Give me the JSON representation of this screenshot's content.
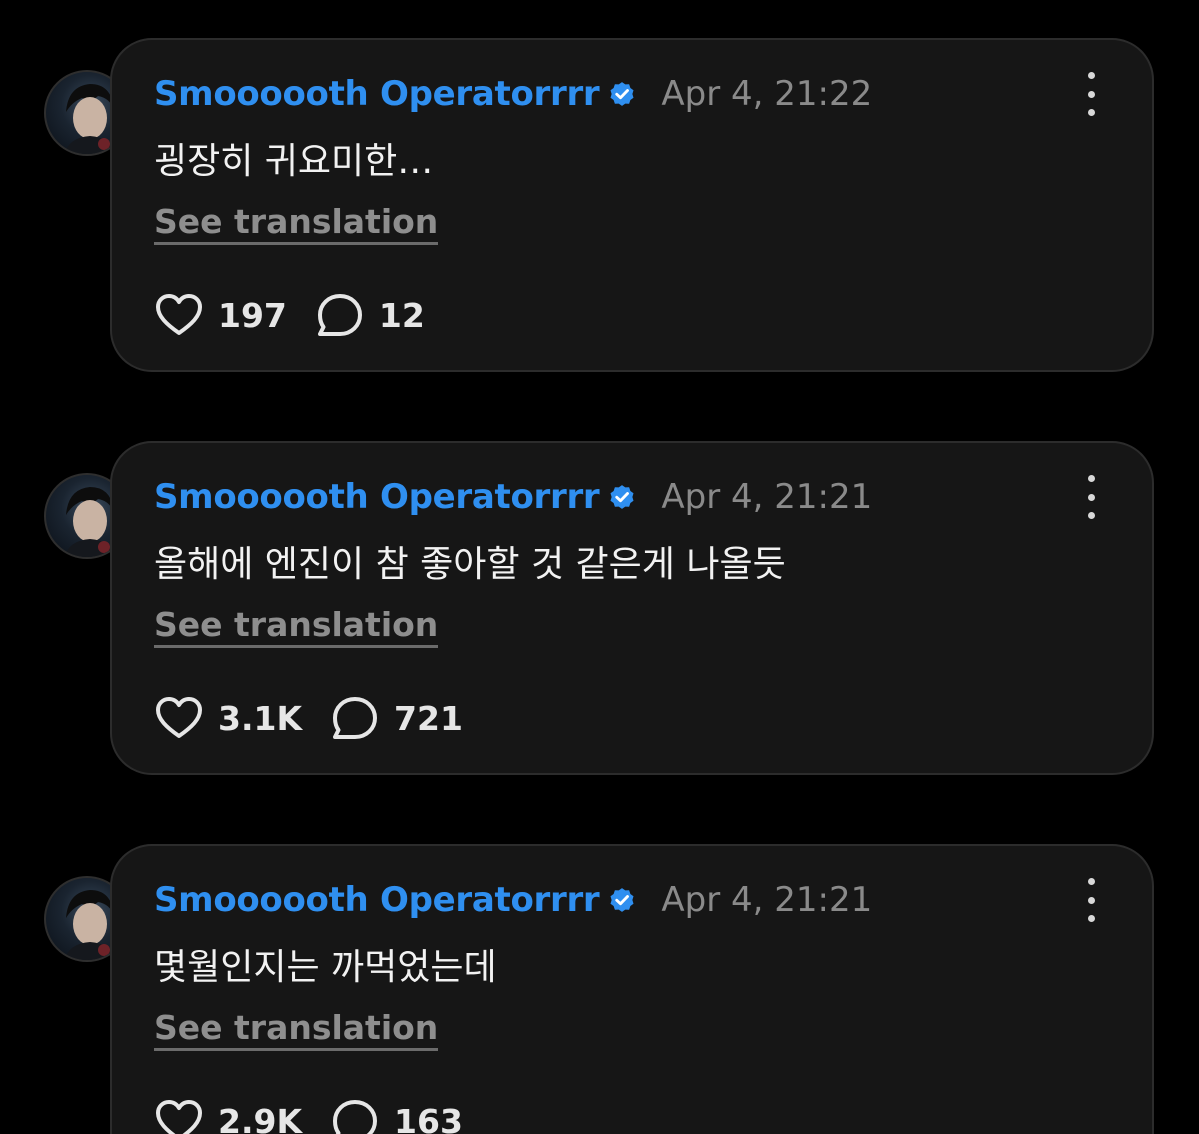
{
  "colors": {
    "background": "#000000",
    "card": "#161616",
    "username": "#2f8ff0",
    "verified": "#2f8ff0",
    "timestamp": "#8a8a8a",
    "text": "#f2f2f2"
  },
  "translation_label": "See translation",
  "posts": [
    {
      "username": "Smoooooth Operatorrrr",
      "verified_icon": "verified-badge-icon",
      "timestamp": "Apr 4, 21:22",
      "text": "굉장히 귀요미한…",
      "likes": "197",
      "replies": "12"
    },
    {
      "username": "Smoooooth Operatorrrr",
      "verified_icon": "verified-badge-icon",
      "timestamp": "Apr 4, 21:21",
      "text": "올해에 엔진이 참 좋아할 것 같은게 나올듯",
      "likes": "3.1K",
      "replies": "721"
    },
    {
      "username": "Smoooooth Operatorrrr",
      "verified_icon": "verified-badge-icon",
      "timestamp": "Apr 4, 21:21",
      "text": "몇월인지는 까먹었는데",
      "likes": "2.9K",
      "replies": "163"
    }
  ]
}
